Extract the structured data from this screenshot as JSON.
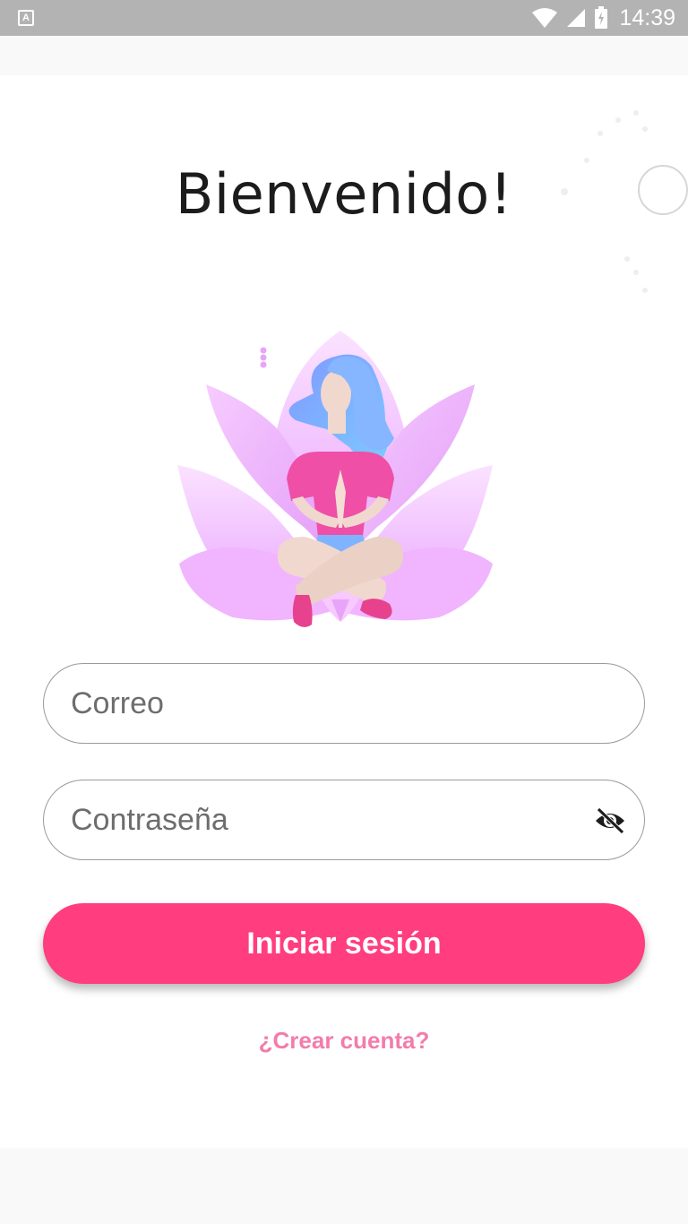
{
  "status_bar": {
    "left_icon_name": "a-icon",
    "left_icon_glyph": "A",
    "time": "14:39",
    "icons": [
      "wifi-icon",
      "signal-icon",
      "battery-icon"
    ]
  },
  "login": {
    "title": "Bienvenido!",
    "email": {
      "placeholder": "Correo",
      "value": ""
    },
    "password": {
      "placeholder": "Contraseña",
      "value": "",
      "visibility_icon": "eye-off-icon"
    },
    "submit_label": "Iniciar sesión",
    "create_account_label": "¿Crear cuenta?"
  },
  "colors": {
    "primary": "#ff3d7f",
    "link": "#f37cab",
    "status_bar": "#b3b3b3",
    "petals": "#f0a8ff"
  },
  "illustration": {
    "icon": "meditation-lotus-illustration"
  }
}
